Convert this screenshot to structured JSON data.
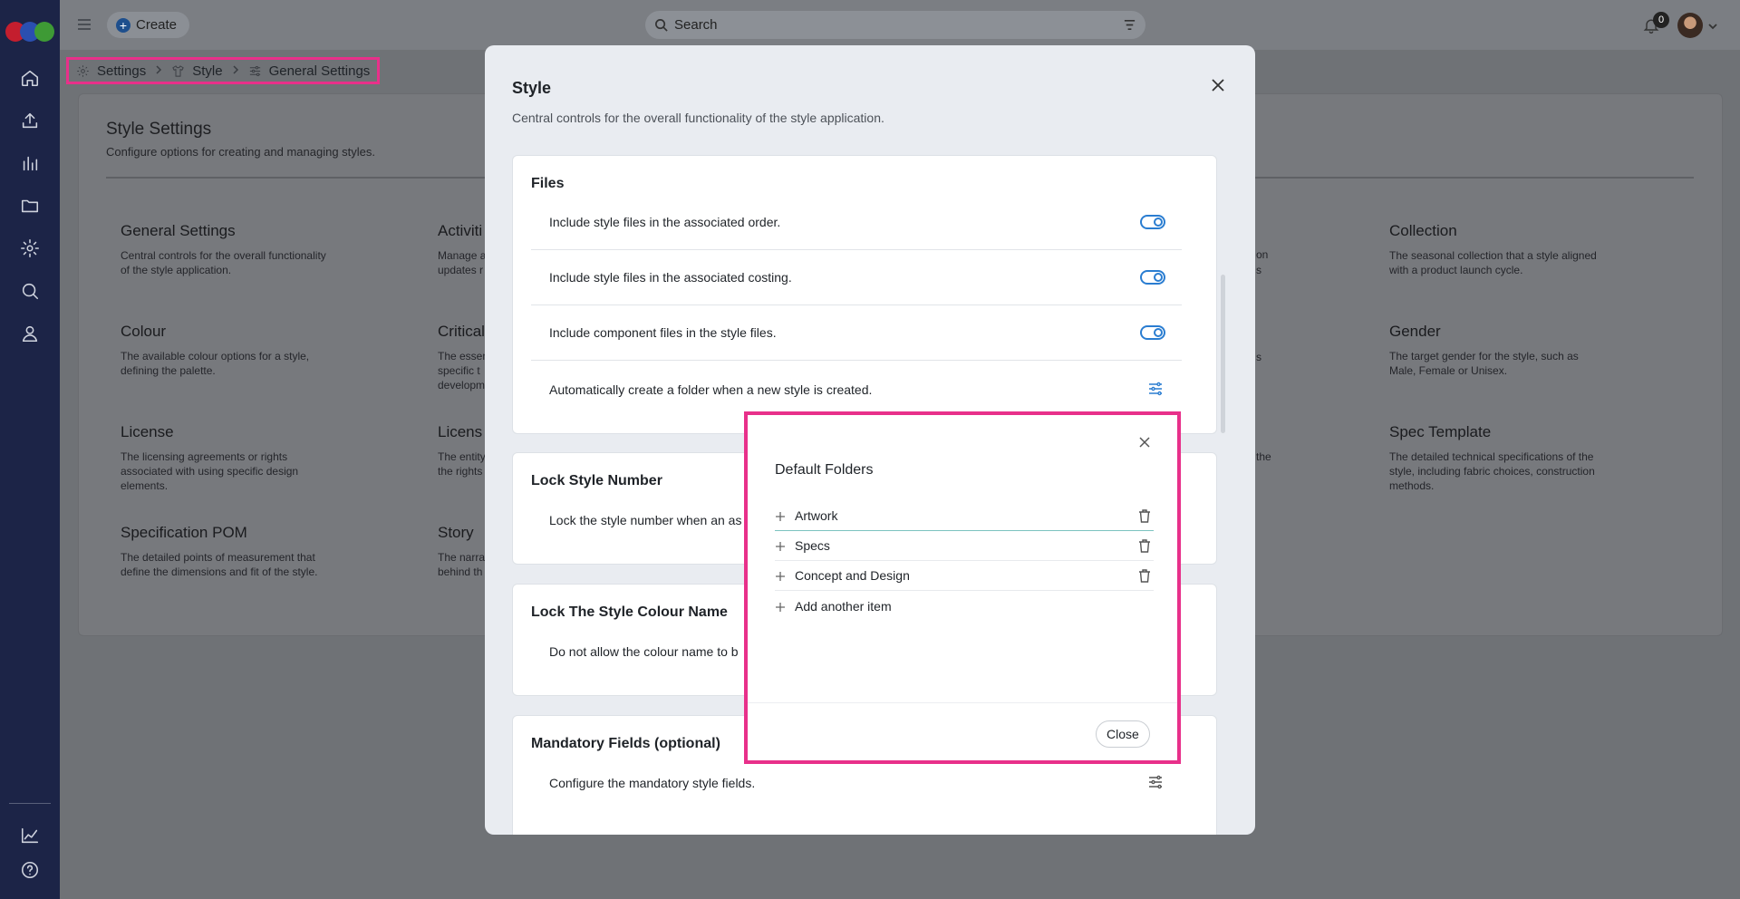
{
  "topbar": {
    "create_label": "Create",
    "search_placeholder": "Search",
    "notification_count": "0"
  },
  "breadcrumb": {
    "items": [
      "Settings",
      "Style",
      "General Settings"
    ]
  },
  "page": {
    "title": "Style Settings",
    "subtitle": "Configure options for creating and managing styles.",
    "items": [
      {
        "title": "General Settings",
        "desc": "Central controls for the overall functionality of the style application."
      },
      {
        "title": "Activiti",
        "desc": "Manage a\nupdates r"
      },
      {
        "title": "Collection",
        "desc": "The seasonal collection that a style aligned with a product launch cycle."
      },
      {
        "title": "Colour",
        "desc": "The available colour options for a style, defining the palette."
      },
      {
        "title": "Critical",
        "desc": "The essen\nspecific t\ndevelopm"
      },
      {
        "title": "Gender",
        "desc": "The target gender for the style, such as Male, Female or Unisex."
      },
      {
        "title": "License",
        "desc": "The licensing agreements or rights associated with using specific design elements."
      },
      {
        "title": "Licens",
        "desc": "The entity\nthe rights"
      },
      {
        "title": "Spec Template",
        "desc": "The detailed technical specifications of the style, including fabric choices, construction methods."
      },
      {
        "title": "Specification POM",
        "desc": "The detailed points of measurement that define the dimensions and fit of the style."
      },
      {
        "title": "Story",
        "desc": "The narra\nbehind th"
      }
    ],
    "partial_right": [
      "on",
      "s",
      "s",
      "the"
    ]
  },
  "modal": {
    "title": "Style",
    "description": "Central controls for the overall functionality of the style application.",
    "files": {
      "heading": "Files",
      "rows": [
        "Include style files in the associated order.",
        "Include style files in the associated costing.",
        "Include component files in the style files.",
        "Automatically create a folder when a new style is created."
      ]
    },
    "lock_number": {
      "heading": "Lock Style Number",
      "row": "Lock the style number when an as"
    },
    "lock_colour": {
      "heading": "Lock The Style Colour Name",
      "row": "Do not allow the colour name to b"
    },
    "mandatory": {
      "heading": "Mandatory Fields (optional)",
      "row": "Configure the mandatory style fields."
    }
  },
  "folders_dialog": {
    "title": "Default Folders",
    "items": [
      "Artwork",
      "Specs",
      "Concept and Design"
    ],
    "add_label": "Add another item",
    "close_label": "Close"
  },
  "colors": {
    "accent": "#2a7dd1",
    "highlight": "#e8308a",
    "sidebar": "#1c2447"
  }
}
